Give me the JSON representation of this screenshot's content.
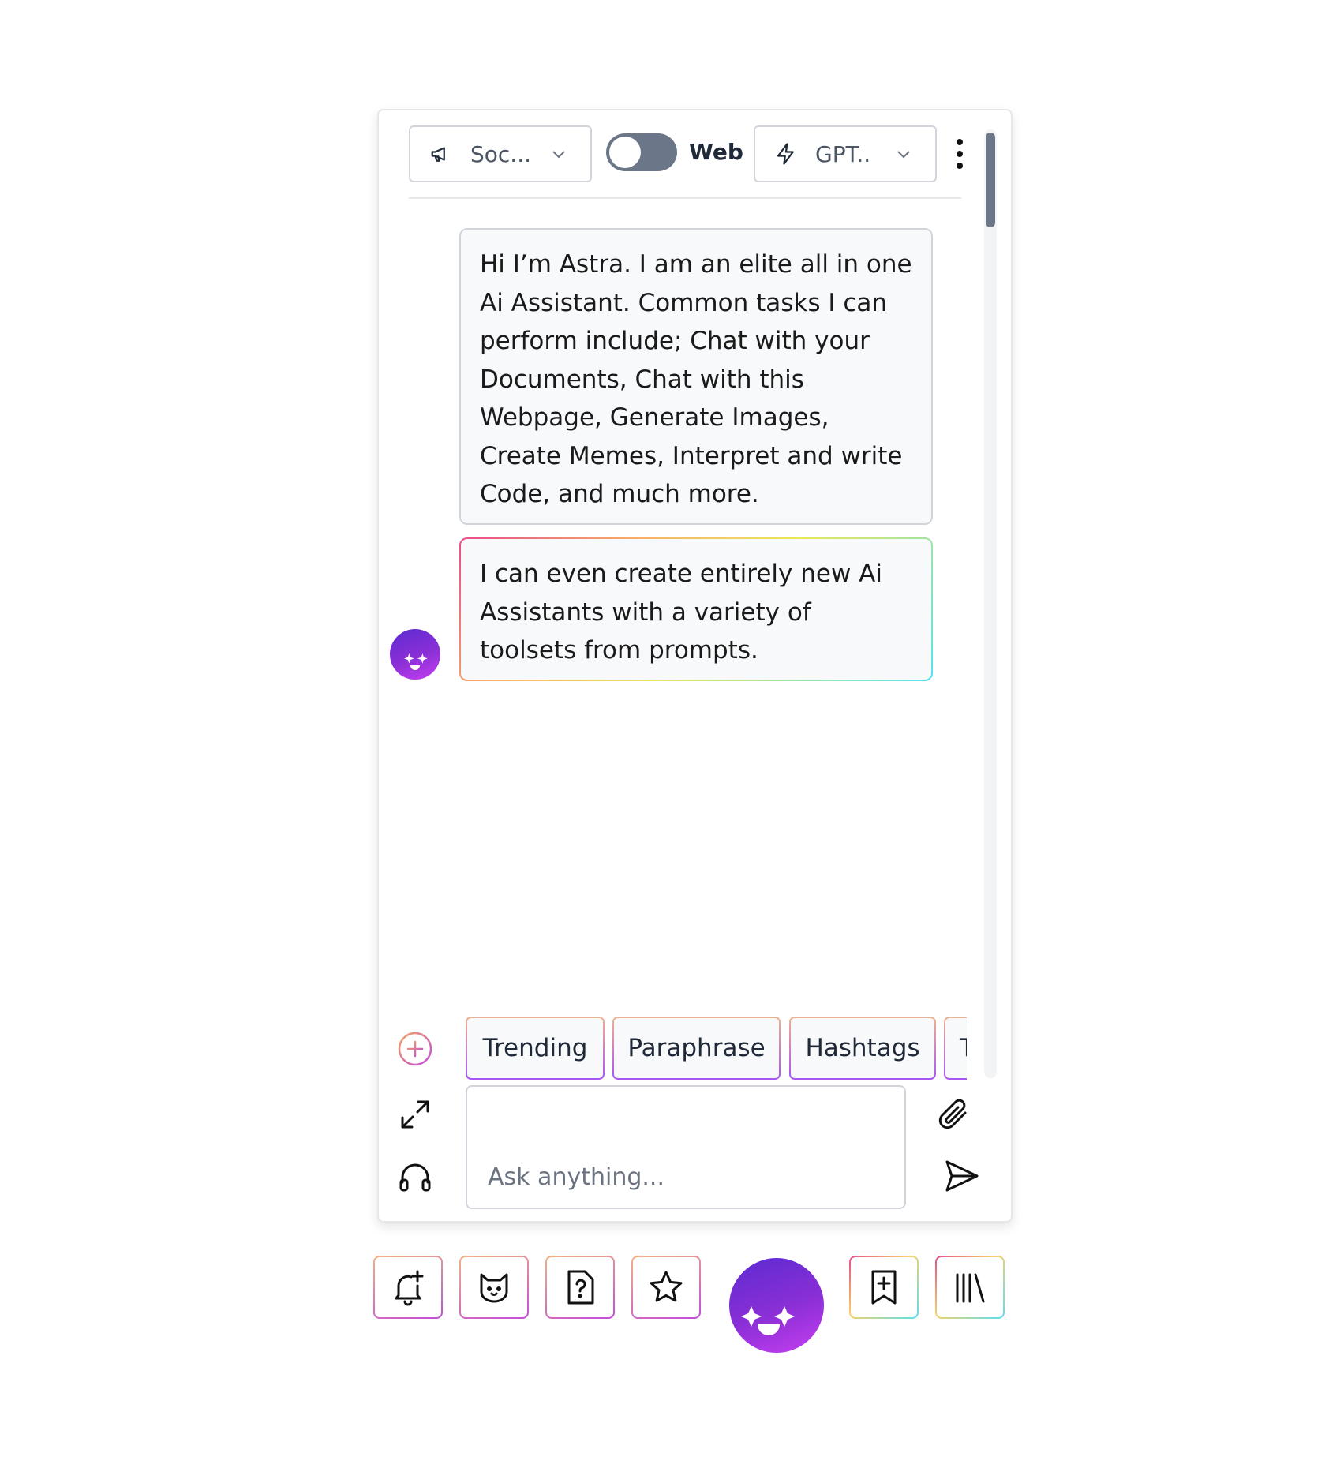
{
  "header": {
    "assistant_select": {
      "label": "Soc...",
      "icon": "megaphone-icon"
    },
    "web_toggle": {
      "label": "Web",
      "state": "off"
    },
    "model_select": {
      "label": "GPT..",
      "icon": "lightning-icon"
    },
    "menu_icon": "vertical-dots-icon"
  },
  "messages": [
    {
      "sender": "assistant",
      "text": "Hi I’m Astra. I am an elite all in one Ai Assistant. Common tasks I can perform include; Chat with your Documents, Chat with this Webpage, Generate Images, Create Memes, Interpret and write Code, and much more."
    },
    {
      "sender": "assistant",
      "text": " I can even create entirely new Ai Assistants with a variety of toolsets from prompts."
    }
  ],
  "quick_prompts": [
    "Trending",
    "Paraphrase",
    "Hashtags",
    "T"
  ],
  "composer": {
    "placeholder": "Ask anything...",
    "left_icons": [
      "add-prompt-icon",
      "expand-icon",
      "headphones-icon"
    ],
    "right_icons": [
      "paperclip-icon",
      "send-icon"
    ]
  },
  "footer_buttons": [
    "bell-plus-icon",
    "cat-icon",
    "help-file-icon",
    "star-icon",
    "astra-avatar",
    "bookmark-plus-icon",
    "library-icon"
  ],
  "colors": {
    "accent_purple": "#8b2fd6",
    "toggle_off": "#6b7788",
    "border": "#d1d5db"
  }
}
